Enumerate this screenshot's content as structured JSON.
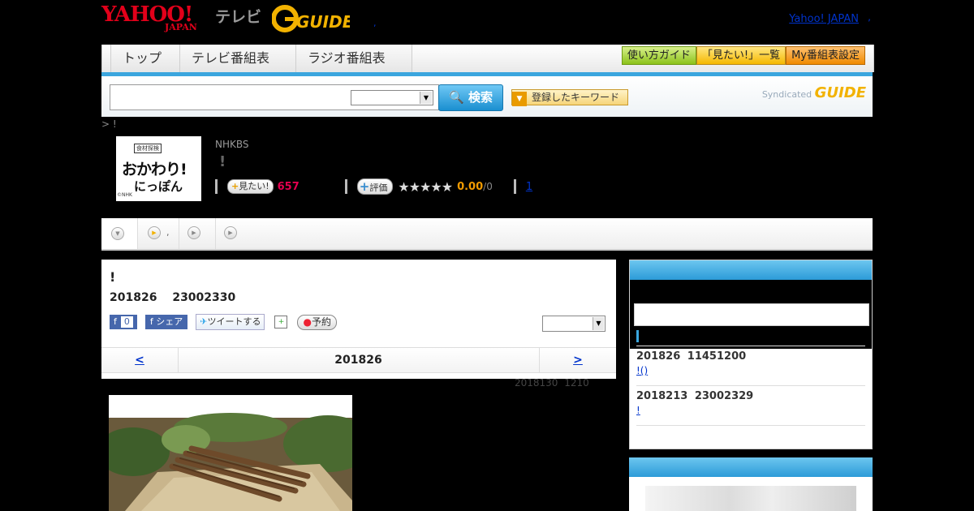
{
  "header": {
    "yahoo_logo": "YAHOO!",
    "japan_logo": "JAPAN",
    "tv_label": "テレビ",
    "gguide_logo": "GUIDE",
    "separator": ",",
    "yahoo_japan_link": "Yahoo! JAPAN",
    "link_separator": ","
  },
  "nav": {
    "tabs": [
      "トップ",
      "テレビ番組表",
      "ラジオ番組表"
    ],
    "buttons": [
      "使い方ガイド",
      "「見たい!」一覧",
      "My番組表設定"
    ]
  },
  "search": {
    "input_value": "",
    "select_value": "",
    "button_label": "検索",
    "keyword_button": "登録したキーワード",
    "syndicated_label": "Syndicated",
    "syndicated_logo": "GUIDE"
  },
  "breadcrumb": ">  !",
  "program": {
    "thumb_tag": "食材探検",
    "thumb_title": "おかわり!",
    "thumb_subtitle": "にっぽん",
    "thumb_copyright": "©NHK",
    "channel": "NHKBS",
    "title": "!",
    "mitai_label": "見たい!",
    "mitai_count": "657",
    "hyoka_label": "評価",
    "stars": "★★★★★",
    "score": "0.00",
    "score_count": "/0",
    "link": "1"
  },
  "subnav": {
    "item2_text": ","
  },
  "detail": {
    "title": "!",
    "datetime": "201826 23002330",
    "fb_count": "0",
    "fb_share": "シェア",
    "tweet": "ツイートする",
    "reserve": "予約",
    "date_prev": "<",
    "date_current": "201826",
    "date_next": ">",
    "updated": "2018130 1210"
  },
  "sidebar": {
    "items": [
      {
        "date": "201826 11451200",
        "link": "!()"
      },
      {
        "date": "2018213 23002329",
        "link": "!"
      }
    ]
  },
  "colors": {
    "accent_blue": "#3ba6de",
    "yahoo_red": "#e2001a",
    "gguide_yellow": "#f2b200",
    "mitai_pink": "#e4004f",
    "score_orange": "#f29b00"
  }
}
